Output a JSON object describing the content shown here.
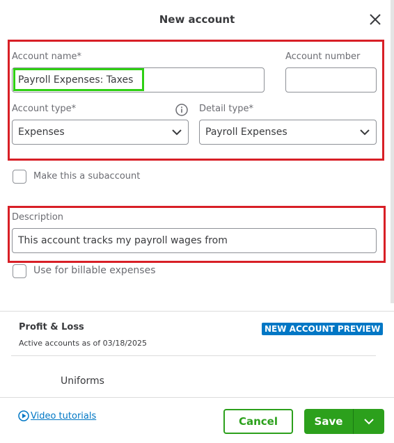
{
  "dialog": {
    "title": "New account"
  },
  "form": {
    "account_name_label": "Account name*",
    "account_name_value": "Payroll Expenses: Taxes",
    "account_number_label": "Account number",
    "account_number_value": "",
    "account_type_label": "Account type*",
    "account_type_value": "Expenses",
    "detail_type_label": "Detail type*",
    "detail_type_value": "Payroll Expenses",
    "subaccount_label": "Make this a subaccount",
    "description_label": "Description",
    "description_value": "This account tracks my payroll wages from",
    "billable_label": "Use for billable expenses"
  },
  "preview": {
    "title": "Profit & Loss",
    "badge": "NEW ACCOUNT PREVIEW",
    "subtitle": "Active accounts as of 03/18/2025",
    "first_item": "Uniforms"
  },
  "footer": {
    "video_link": "Video tutorials",
    "cancel_label": "Cancel",
    "save_label": "Save"
  },
  "colors": {
    "annotation_red": "#d81f26",
    "annotation_green": "#2ed013",
    "primary_green": "#2ca01c",
    "badge_blue": "#0077c5",
    "link_blue": "#0077c5"
  },
  "icons": [
    "close-icon",
    "info-icon",
    "chevron-down-icon",
    "play-circle-icon"
  ]
}
